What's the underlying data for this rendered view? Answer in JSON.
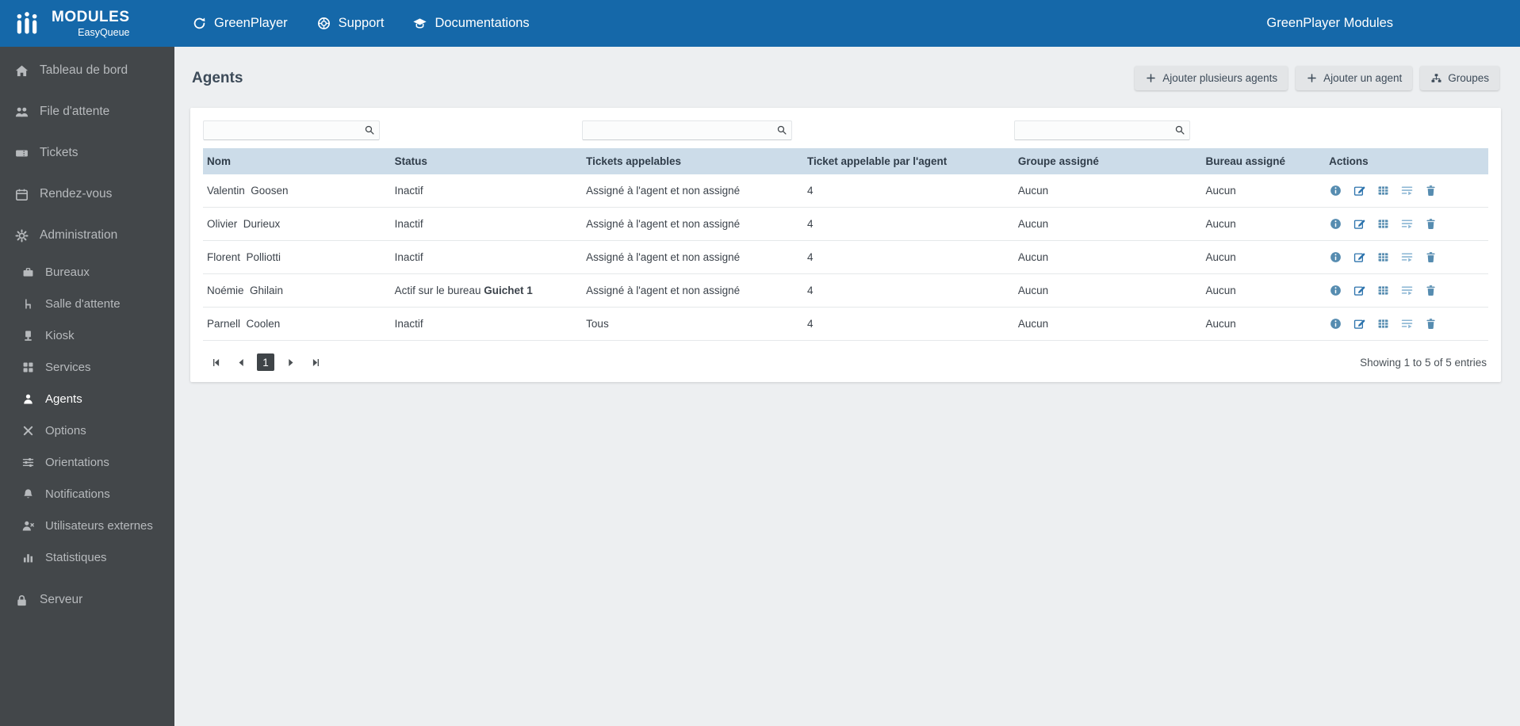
{
  "colors": {
    "topbar_blue": "#1568a9",
    "sidebar_gray": "#43474a",
    "table_header_bg": "#ccdce9",
    "accent_blue": "#568cb0"
  },
  "topbar": {
    "logo_title": "MODULES",
    "logo_subtitle": "EasyQueue",
    "nav": [
      {
        "label": "GreenPlayer",
        "icon": "circular-arrow"
      },
      {
        "label": "Support",
        "icon": "life-ring"
      },
      {
        "label": "Documentations",
        "icon": "graduation-cap"
      }
    ],
    "right_title": "GreenPlayer Modules"
  },
  "sidebar": {
    "items": [
      {
        "label": "Tableau de bord",
        "icon": "home"
      },
      {
        "label": "File d'attente",
        "icon": "people-queue"
      },
      {
        "label": "Tickets",
        "icon": "ticket"
      },
      {
        "label": "Rendez-vous",
        "icon": "calendar"
      },
      {
        "label": "Administration",
        "icon": "gear"
      },
      {
        "label": "Bureaux",
        "icon": "briefcase",
        "sub": true
      },
      {
        "label": "Salle d'attente",
        "icon": "chair",
        "sub": true
      },
      {
        "label": "Kiosk",
        "icon": "kiosk-terminal",
        "sub": true
      },
      {
        "label": "Services",
        "icon": "grid",
        "sub": true
      },
      {
        "label": "Agents",
        "icon": "person",
        "sub": true,
        "active": true
      },
      {
        "label": "Options",
        "icon": "crossed-tools",
        "sub": true
      },
      {
        "label": "Orientations",
        "icon": "sliders",
        "sub": true
      },
      {
        "label": "Notifications",
        "icon": "bell",
        "sub": true
      },
      {
        "label": "Utilisateurs externes",
        "icon": "user-x",
        "sub": true
      },
      {
        "label": "Statistiques",
        "icon": "bar-chart",
        "sub": true
      },
      {
        "label": "Serveur",
        "icon": "lock"
      }
    ]
  },
  "page": {
    "title": "Agents",
    "buttons": [
      {
        "label": "Ajouter plusieurs agents",
        "icon": "plus"
      },
      {
        "label": "Ajouter un agent",
        "icon": "plus"
      },
      {
        "label": "Groupes",
        "icon": "sitemap"
      }
    ]
  },
  "search": {
    "nom_value": "",
    "tickets_appelables_value": "",
    "groupe_assigne_value": ""
  },
  "table": {
    "headers": [
      "Nom",
      "Status",
      "Tickets appelables",
      "Ticket appelable par l'agent",
      "Groupe assigné",
      "Bureau assigné",
      "Actions"
    ],
    "action_icons": [
      "info",
      "edit-pencil",
      "table-grid",
      "playlist-add",
      "trash"
    ],
    "rows": [
      {
        "nom": "Valentin  Goosen",
        "status": "Inactif",
        "status_bold": "",
        "tickets": "Assigné à l'agent et non assigné",
        "ticket_par_agent": "4",
        "groupe": "Aucun",
        "bureau": "Aucun"
      },
      {
        "nom": "Olivier  Durieux",
        "status": "Inactif",
        "status_bold": "",
        "tickets": "Assigné à l'agent et non assigné",
        "ticket_par_agent": "4",
        "groupe": "Aucun",
        "bureau": "Aucun"
      },
      {
        "nom": "Florent  Polliotti",
        "status": "Inactif",
        "status_bold": "",
        "tickets": "Assigné à l'agent et non assigné",
        "ticket_par_agent": "4",
        "groupe": "Aucun",
        "bureau": "Aucun"
      },
      {
        "nom": "Noémie  Ghilain",
        "status": "Actif sur le bureau ",
        "status_bold": "Guichet 1",
        "tickets": "Assigné à l'agent et non assigné",
        "ticket_par_agent": "4",
        "groupe": "Aucun",
        "bureau": "Aucun"
      },
      {
        "nom": "Parnell  Coolen",
        "status": "Inactif",
        "status_bold": "",
        "tickets": "Tous",
        "ticket_par_agent": "4",
        "groupe": "Aucun",
        "bureau": "Aucun"
      }
    ]
  },
  "footer": {
    "current_page": "1",
    "summary": "Showing 1 to 5 of 5 entries"
  }
}
